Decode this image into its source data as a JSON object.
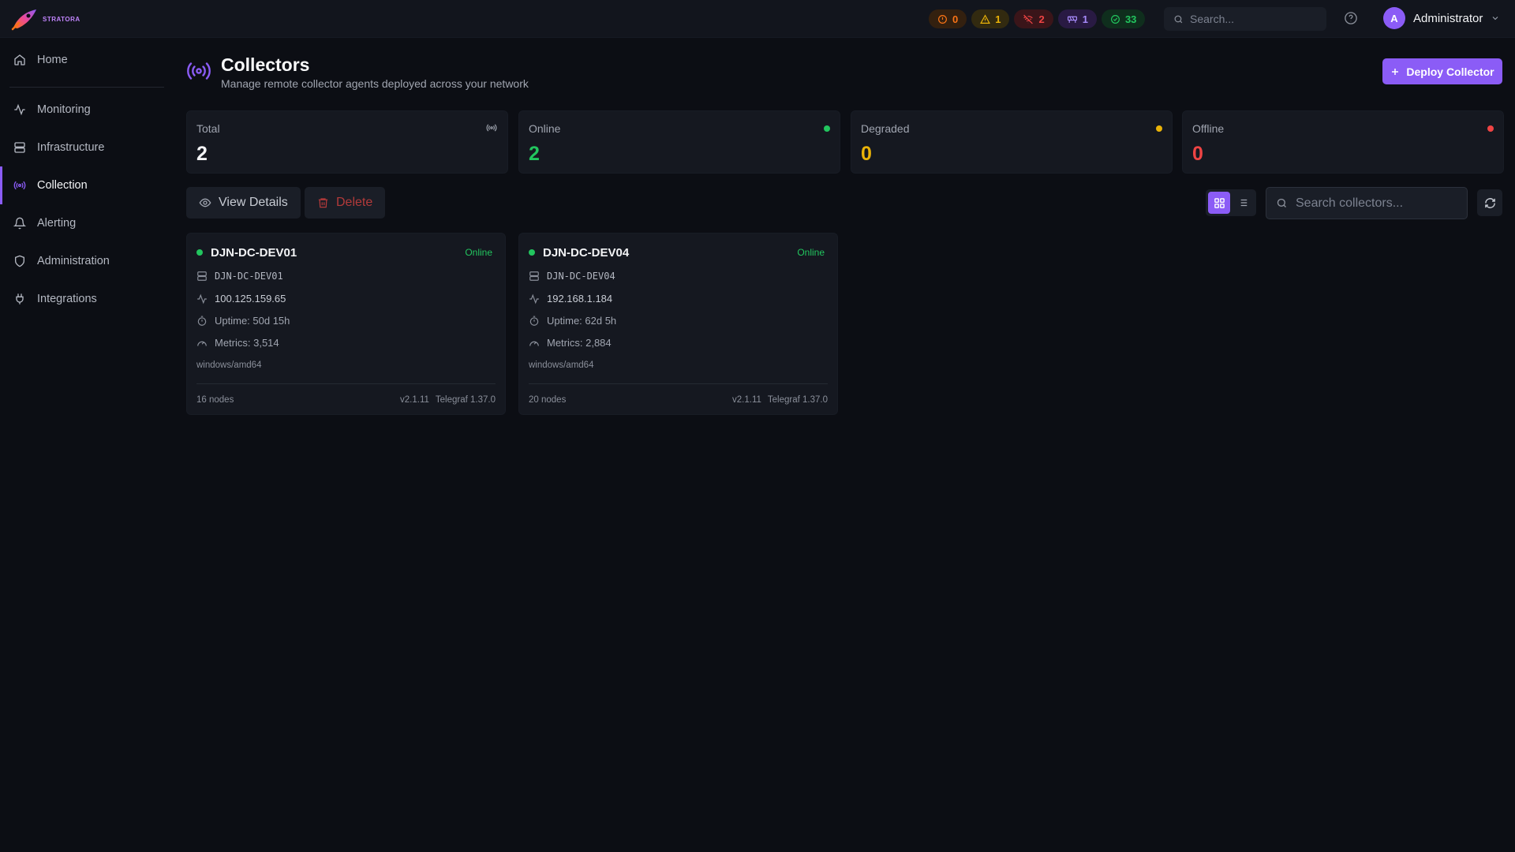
{
  "brand": {
    "name": "STRATORA"
  },
  "topbar": {
    "pills": [
      {
        "kind": "crit",
        "icon": "alert-circle-icon",
        "count": "0"
      },
      {
        "kind": "warn",
        "icon": "warning-triangle-icon",
        "count": "1"
      },
      {
        "kind": "down",
        "icon": "wifi-off-icon",
        "count": "2"
      },
      {
        "kind": "maint",
        "icon": "construction-icon",
        "count": "1"
      },
      {
        "kind": "ok",
        "icon": "check-circle-icon",
        "count": "33"
      }
    ],
    "search_placeholder": "Search...",
    "user": {
      "initial": "A",
      "name": "Administrator"
    }
  },
  "sidebar": {
    "items": [
      {
        "label": "Home",
        "icon": "home-icon"
      },
      {
        "label": "Monitoring",
        "icon": "activity-icon"
      },
      {
        "label": "Infrastructure",
        "icon": "server-icon"
      },
      {
        "label": "Collection",
        "icon": "radio-icon",
        "active": true
      },
      {
        "label": "Alerting",
        "icon": "bell-icon"
      },
      {
        "label": "Administration",
        "icon": "shield-icon"
      },
      {
        "label": "Integrations",
        "icon": "plug-icon"
      }
    ]
  },
  "header": {
    "title": "Collectors",
    "subtitle": "Manage remote collector agents deployed across your network",
    "deploy_label": "Deploy Collector"
  },
  "stats": [
    {
      "label": "Total",
      "value": "2",
      "color": "#f3f4f6"
    },
    {
      "label": "Online",
      "value": "2",
      "color": "#22c55e"
    },
    {
      "label": "Degraded",
      "value": "0",
      "color": "#eab308"
    },
    {
      "label": "Offline",
      "value": "0",
      "color": "#ef4444"
    }
  ],
  "toolbar": {
    "view_details_label": "View Details",
    "delete_label": "Delete",
    "search_placeholder": "Search collectors...",
    "view_mode": "grid"
  },
  "collectors": [
    {
      "name": "DJN-DC-DEV01",
      "status": "Online",
      "hostname": "DJN-DC-DEV01",
      "ip": "100.125.159.65",
      "uptime": "Uptime: 50d 15h",
      "metrics": "Metrics: 3,514",
      "platform": "windows/amd64",
      "nodes": "16 nodes",
      "version": "v2.1.11",
      "telegraf": "Telegraf 1.37.0"
    },
    {
      "name": "DJN-DC-DEV04",
      "status": "Online",
      "hostname": "DJN-DC-DEV04",
      "ip": "192.168.1.184",
      "uptime": "Uptime: 62d 5h",
      "metrics": "Metrics: 2,884",
      "platform": "windows/amd64",
      "nodes": "20 nodes",
      "version": "v2.1.11",
      "telegraf": "Telegraf 1.37.0"
    }
  ]
}
